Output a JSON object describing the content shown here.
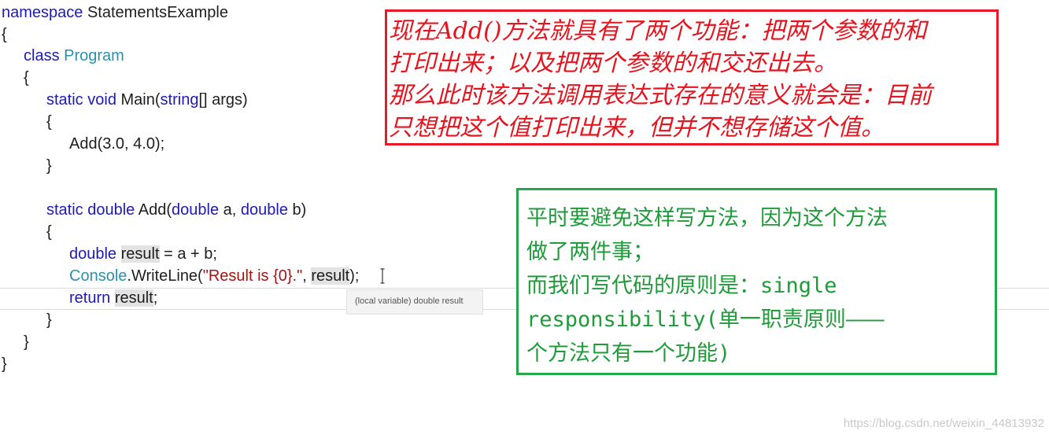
{
  "code": {
    "namespace_kw": "namespace",
    "namespace_name": "StatementsExample",
    "class_kw": "class",
    "class_name": "Program",
    "main_static": "static",
    "main_void": "void",
    "main_name": "Main(",
    "main_string": "string",
    "main_args": "[] args)",
    "call_add": "Add(3.0, 4.0);",
    "add_static": "static",
    "add_double": "double",
    "add_name": "Add(",
    "add_param_a_type": "double",
    "add_param_a": "a,",
    "add_param_b_type": "double",
    "add_param_b": "b)",
    "decl_type": "double",
    "decl_var": "result",
    "decl_rest": "= a + b;",
    "console_cls": "Console",
    "console_method": ".WriteLine(",
    "console_str": "\"Result is {0}.\"",
    "console_sep": ", ",
    "console_var": "result",
    "console_end": ");",
    "return_kw": "return",
    "return_var": "result",
    "return_end": ";",
    "open_brace": "{",
    "close_brace": "}"
  },
  "tooltip": {
    "text": "(local variable) double result"
  },
  "notes": {
    "red": [
      "现在Add()方法就具有了两个功能：把两个参数的和",
      "打印出来；以及把两个参数的和交还出去。",
      "那么此时该方法调用表达式存在的意义就会是：目前",
      "只想把这个值打印出来，但并不想存储这个值。"
    ],
    "green": [
      "平时要避免这样写方法，因为这个方法",
      "做了两件事；",
      "而我们写代码的原则是：single",
      "responsibility(单一职责原则———",
      "个方法只有一个功能)"
    ]
  },
  "watermark": "https://blog.csdn.net/weixin_44813932",
  "colors": {
    "keyword": "#1d1ab5",
    "type": "#2b91af",
    "string": "#a31515",
    "red_note": "#e5151f",
    "green_note": "#1f9b3a"
  }
}
